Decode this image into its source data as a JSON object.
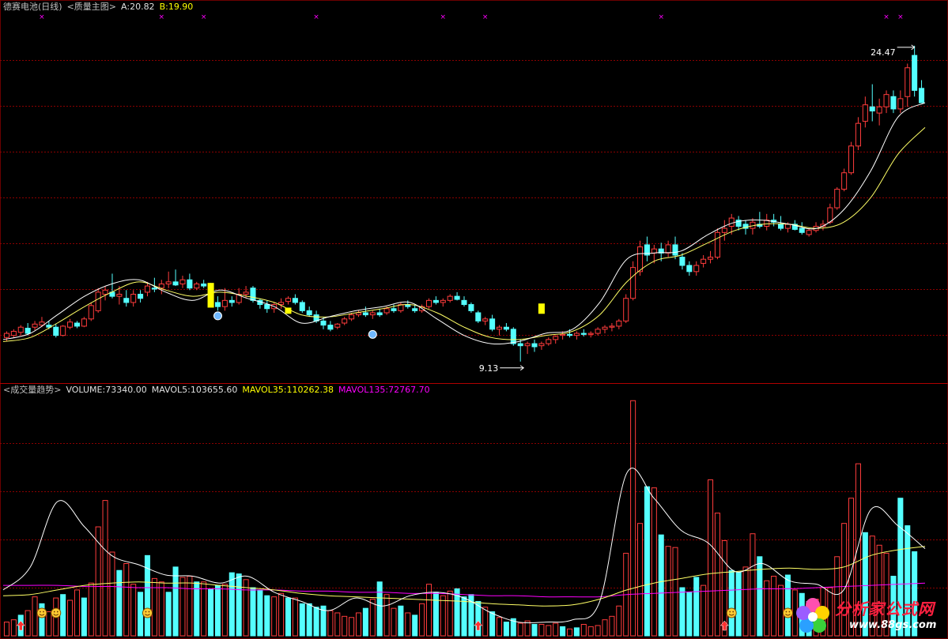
{
  "header": {
    "stock_name": "德赛电池(日线)",
    "indicator_main": "<质量主图>",
    "a_label": "A:20.82",
    "b_label": "B:19.90"
  },
  "volume_header": {
    "indicator": "<成交量趋势>",
    "volume": "VOLUME:73340.00",
    "mavol5": "MAVOL5:103655.60",
    "mavol35": "MAVOL35:110262.38",
    "mavol135": "MAVOL135:72767.70"
  },
  "annotations": {
    "high_label": "24.47",
    "low_label": "9.13"
  },
  "logo": {
    "text": "分析家公式网",
    "url": "www.88gs.com"
  },
  "colors": {
    "background": "#000000",
    "up": "#ff3c3c",
    "down": "#54ffff",
    "ma_short": "#ffffff",
    "ma_long": "#ffff66",
    "ma_vol135": "#ff00ff",
    "grid": "#8b0000",
    "marker_x": "#ff00ff",
    "signal_yellow": "#ffff00"
  },
  "chart_data": [
    {
      "type": "candlestick",
      "title": "德赛电池(日线)",
      "ylim": [
        8.2,
        26.0
      ],
      "grid": true,
      "ohlc": [
        [
          10.3,
          10.6,
          10.1,
          10.5
        ],
        [
          10.4,
          10.7,
          10.3,
          10.6
        ],
        [
          10.55,
          10.9,
          10.4,
          10.8
        ],
        [
          10.75,
          11.0,
          10.4,
          10.5
        ],
        [
          10.8,
          11.1,
          10.65,
          10.95
        ],
        [
          10.9,
          11.3,
          10.8,
          11.05
        ],
        [
          10.9,
          11.1,
          10.7,
          10.8
        ],
        [
          10.8,
          10.95,
          10.3,
          10.4
        ],
        [
          10.4,
          10.9,
          10.35,
          10.85
        ],
        [
          10.8,
          11.2,
          10.7,
          11.05
        ],
        [
          11.0,
          11.1,
          10.75,
          10.85
        ],
        [
          10.85,
          11.3,
          10.8,
          11.2
        ],
        [
          11.2,
          12.0,
          11.1,
          11.85
        ],
        [
          11.6,
          12.7,
          11.5,
          12.5
        ],
        [
          12.4,
          12.8,
          12.1,
          12.6
        ],
        [
          12.5,
          13.4,
          12.2,
          12.3
        ],
        [
          12.3,
          12.8,
          11.9,
          12.4
        ],
        [
          12.2,
          12.6,
          11.8,
          12.0
        ],
        [
          12.0,
          12.6,
          11.8,
          12.4
        ],
        [
          12.4,
          12.6,
          12.0,
          12.2
        ],
        [
          12.5,
          13.0,
          12.3,
          12.8
        ],
        [
          12.7,
          13.2,
          12.5,
          12.65
        ],
        [
          12.7,
          13.1,
          12.4,
          12.9
        ],
        [
          12.9,
          13.5,
          12.7,
          13.0
        ],
        [
          13.0,
          13.6,
          12.8,
          12.85
        ],
        [
          12.9,
          13.3,
          12.7,
          13.1
        ],
        [
          13.1,
          13.4,
          12.6,
          12.7
        ],
        [
          12.7,
          13.0,
          12.6,
          12.9
        ],
        [
          12.9,
          13.1,
          12.7,
          12.8
        ],
        [
          12.9,
          12.95,
          11.8,
          12.0
        ],
        [
          12.0,
          12.3,
          11.6,
          11.8
        ],
        [
          11.8,
          12.7,
          11.6,
          12.1
        ],
        [
          12.1,
          12.3,
          11.8,
          12.0
        ],
        [
          12.0,
          12.7,
          11.9,
          12.4
        ],
        [
          12.4,
          12.8,
          12.2,
          12.5
        ],
        [
          12.7,
          12.8,
          12.0,
          12.1
        ],
        [
          12.1,
          12.2,
          11.7,
          11.9
        ],
        [
          11.9,
          12.1,
          11.5,
          11.7
        ],
        [
          11.7,
          12.0,
          11.5,
          11.9
        ],
        [
          11.9,
          12.2,
          11.7,
          12.0
        ],
        [
          12.05,
          12.3,
          11.9,
          12.2
        ],
        [
          12.2,
          12.4,
          11.9,
          12.0
        ],
        [
          12.0,
          12.1,
          11.5,
          11.6
        ],
        [
          11.6,
          11.8,
          11.3,
          11.4
        ],
        [
          11.4,
          11.6,
          11.0,
          11.1
        ],
        [
          11.1,
          11.3,
          10.7,
          10.9
        ],
        [
          10.9,
          11.1,
          10.6,
          10.7
        ],
        [
          10.8,
          11.0,
          10.7,
          10.95
        ],
        [
          11.0,
          11.3,
          10.9,
          11.2
        ],
        [
          11.2,
          11.5,
          11.1,
          11.4
        ],
        [
          11.4,
          11.6,
          11.3,
          11.5
        ],
        [
          11.5,
          11.8,
          11.3,
          11.4
        ],
        [
          11.4,
          11.6,
          11.2,
          11.5
        ],
        [
          11.5,
          11.7,
          11.3,
          11.4
        ],
        [
          11.5,
          11.8,
          11.4,
          11.7
        ],
        [
          11.7,
          11.9,
          11.5,
          11.6
        ],
        [
          11.6,
          12.0,
          11.5,
          11.9
        ],
        [
          11.9,
          12.1,
          11.7,
          11.8
        ],
        [
          11.7,
          11.9,
          11.5,
          11.6
        ],
        [
          11.6,
          11.9,
          11.5,
          11.8
        ],
        [
          11.8,
          12.2,
          11.7,
          12.1
        ],
        [
          12.1,
          12.3,
          11.9,
          12.0
        ],
        [
          12.0,
          12.2,
          11.8,
          12.1
        ],
        [
          12.1,
          12.4,
          12.0,
          12.3
        ],
        [
          12.3,
          12.5,
          12.1,
          12.15
        ],
        [
          12.1,
          12.3,
          11.8,
          11.9
        ],
        [
          11.9,
          12.0,
          11.5,
          11.6
        ],
        [
          11.5,
          11.6,
          11.0,
          11.1
        ],
        [
          11.1,
          11.3,
          10.9,
          11.2
        ],
        [
          11.2,
          11.4,
          10.6,
          10.7
        ],
        [
          10.7,
          10.9,
          10.4,
          10.8
        ],
        [
          10.8,
          11.0,
          10.6,
          10.7
        ],
        [
          10.7,
          10.8,
          9.9,
          10.0
        ],
        [
          10.0,
          10.2,
          9.13,
          9.9
        ],
        [
          9.9,
          10.1,
          9.5,
          10.0
        ],
        [
          10.0,
          10.2,
          9.6,
          9.85
        ],
        [
          9.9,
          10.1,
          9.7,
          10.0
        ],
        [
          10.0,
          10.3,
          9.9,
          10.2
        ],
        [
          10.2,
          10.4,
          10.0,
          10.35
        ],
        [
          10.4,
          10.6,
          10.2,
          10.45
        ],
        [
          10.45,
          10.7,
          10.3,
          10.4
        ],
        [
          10.4,
          10.6,
          10.2,
          10.5
        ],
        [
          10.5,
          10.7,
          10.35,
          10.45
        ],
        [
          10.45,
          10.6,
          10.3,
          10.5
        ],
        [
          10.5,
          10.8,
          10.4,
          10.7
        ],
        [
          10.7,
          10.9,
          10.5,
          10.8
        ],
        [
          10.8,
          11.0,
          10.6,
          10.85
        ],
        [
          10.85,
          11.2,
          10.7,
          11.1
        ],
        [
          11.1,
          12.4,
          11.0,
          12.2
        ],
        [
          12.2,
          14.0,
          12.1,
          13.7
        ],
        [
          13.5,
          15.0,
          13.3,
          14.7
        ],
        [
          14.8,
          15.2,
          14.0,
          14.3
        ],
        [
          14.4,
          14.8,
          13.9,
          14.6
        ],
        [
          14.6,
          14.9,
          14.0,
          14.4
        ],
        [
          14.4,
          15.0,
          14.2,
          14.8
        ],
        [
          14.8,
          15.2,
          14.1,
          14.3
        ],
        [
          14.2,
          14.4,
          13.6,
          13.8
        ],
        [
          13.8,
          14.0,
          13.3,
          13.5
        ],
        [
          13.5,
          14.0,
          13.3,
          13.8
        ],
        [
          13.9,
          14.3,
          13.7,
          14.1
        ],
        [
          14.1,
          14.5,
          13.9,
          14.2
        ],
        [
          14.2,
          15.6,
          14.1,
          15.4
        ],
        [
          15.4,
          16.0,
          15.0,
          15.6
        ],
        [
          15.7,
          16.3,
          15.3,
          16.1
        ],
        [
          16.0,
          16.2,
          15.5,
          15.7
        ],
        [
          15.8,
          16.0,
          15.3,
          15.6
        ],
        [
          15.6,
          16.1,
          15.3,
          15.9
        ],
        [
          15.8,
          16.4,
          15.6,
          15.7
        ],
        [
          15.7,
          16.3,
          15.5,
          16.0
        ],
        [
          16.0,
          16.3,
          15.7,
          15.9
        ],
        [
          15.8,
          16.2,
          15.5,
          15.6
        ],
        [
          15.6,
          15.9,
          15.4,
          15.8
        ],
        [
          15.8,
          16.0,
          15.5,
          15.55
        ],
        [
          15.6,
          15.9,
          15.3,
          15.4
        ],
        [
          15.3,
          15.6,
          15.2,
          15.5
        ],
        [
          15.5,
          15.9,
          15.4,
          15.7
        ],
        [
          15.7,
          16.0,
          15.5,
          15.8
        ],
        [
          15.9,
          16.8,
          15.8,
          16.6
        ],
        [
          16.6,
          17.6,
          16.5,
          17.5
        ],
        [
          17.5,
          18.5,
          17.4,
          18.3
        ],
        [
          18.3,
          19.8,
          18.2,
          19.6
        ],
        [
          19.6,
          21.0,
          19.4,
          20.7
        ],
        [
          20.8,
          22.0,
          20.5,
          21.6
        ],
        [
          21.5,
          22.6,
          20.8,
          21.3
        ],
        [
          21.2,
          21.9,
          20.6,
          21.5
        ],
        [
          21.5,
          22.3,
          21.2,
          22.1
        ],
        [
          22.0,
          22.3,
          21.2,
          21.4
        ],
        [
          21.4,
          22.3,
          21.2,
          21.9
        ],
        [
          22.0,
          23.6,
          21.5,
          23.4
        ],
        [
          24.0,
          24.47,
          22.0,
          22.3
        ],
        [
          22.4,
          22.8,
          21.7,
          21.7
        ]
      ],
      "ma_short_anchors": [
        10.2,
        10.5,
        11.4,
        12.3,
        12.9,
        13.1,
        12.5,
        12.1,
        12.6,
        12.2,
        11.8,
        11.0,
        11.3,
        11.6,
        11.8,
        12.0,
        11.2,
        10.4,
        10.0,
        10.1,
        10.5,
        10.7,
        12.0,
        14.1,
        14.4,
        14.5,
        15.3,
        15.9,
        16.0,
        15.8,
        15.6,
        16.5,
        18.4,
        21.0,
        21.7
      ],
      "ma_long_anchors": [
        10.1,
        10.3,
        11.0,
        11.8,
        12.5,
        13.0,
        12.6,
        12.3,
        12.5,
        12.3,
        12.0,
        11.4,
        11.3,
        11.5,
        11.7,
        11.9,
        11.5,
        10.8,
        10.3,
        10.2,
        10.4,
        10.6,
        11.4,
        13.0,
        14.0,
        14.3,
        14.9,
        15.5,
        15.8,
        15.8,
        15.6,
        15.9,
        17.1,
        19.2,
        20.5
      ],
      "high_marker": 24.47,
      "low_marker": 9.13
    },
    {
      "type": "bar",
      "title": "<成交量趋势>",
      "ylim": [
        0,
        210000
      ],
      "grid": true,
      "volume": [
        12000,
        14000,
        18000,
        22000,
        34000,
        28000,
        21000,
        33000,
        36000,
        31000,
        40000,
        33000,
        46000,
        95000,
        118000,
        73000,
        57000,
        63000,
        45000,
        38000,
        70000,
        50000,
        47000,
        38000,
        60000,
        51000,
        52000,
        47000,
        47000,
        41000,
        44000,
        45000,
        55000,
        54000,
        49000,
        42000,
        40000,
        35000,
        34000,
        37000,
        33000,
        33000,
        28000,
        28000,
        25000,
        26000,
        22000,
        20000,
        17000,
        16000,
        20000,
        24000,
        32000,
        47000,
        36000,
        24000,
        26000,
        20000,
        18000,
        28000,
        45000,
        38000,
        35000,
        39000,
        41000,
        34000,
        36000,
        30000,
        25000,
        21000,
        16000,
        12000,
        15000,
        11000,
        13000,
        10000,
        10000,
        9000,
        11000,
        8000,
        6000,
        7000,
        10000,
        8000,
        9000,
        14000,
        17000,
        26000,
        72000,
        205000,
        98000,
        130000,
        129000,
        88000,
        78000,
        77000,
        42000,
        38000,
        51000,
        44000,
        136000,
        107000,
        83000,
        57000,
        55000,
        60000,
        89000,
        69000,
        48000,
        52000,
        44000,
        53000,
        40000,
        37000,
        30000,
        32000,
        42000,
        42000,
        69000,
        98000,
        120000,
        150000,
        90000,
        87000,
        79000,
        72000,
        52000,
        120000,
        96000,
        73340
      ],
      "vol_up": [
        1,
        1,
        0,
        1,
        1,
        0,
        1,
        1,
        0,
        1,
        1,
        0,
        1,
        1,
        1,
        1,
        0,
        1,
        1,
        0,
        0,
        1,
        1,
        0,
        0,
        1,
        1,
        0,
        1,
        0,
        0,
        1,
        0,
        0,
        1,
        0,
        0,
        0,
        1,
        1,
        0,
        1,
        0,
        0,
        0,
        0,
        1,
        1,
        1,
        1,
        1,
        0,
        1,
        0,
        1,
        1,
        0,
        1,
        0,
        1,
        1,
        0,
        1,
        1,
        0,
        0,
        0,
        0,
        1,
        0,
        1,
        0,
        0,
        1,
        1,
        0,
        1,
        1,
        1,
        0,
        1,
        0,
        1,
        1,
        1,
        1,
        1,
        1,
        1,
        1,
        1,
        0,
        1,
        0,
        1,
        1,
        0,
        0,
        0,
        1,
        1,
        1,
        1,
        0,
        0,
        1,
        1,
        0,
        1,
        1,
        1,
        0,
        1,
        0,
        0,
        1,
        1,
        1,
        1,
        1,
        1,
        1,
        0,
        1,
        1,
        1,
        0,
        0,
        0
      ],
      "ma5_anchors": [
        40000,
        60000,
        117000,
        95000,
        70000,
        62000,
        53000,
        52000,
        46000,
        52000,
        38000,
        30000,
        22000,
        33000,
        26000,
        35000,
        38000,
        33000,
        20000,
        12000,
        12000,
        14000,
        30000,
        142000,
        120000,
        92000,
        81000,
        56000,
        63000,
        48000,
        45000,
        40000,
        110000,
        96000,
        76000
      ],
      "ma35_anchors": [
        35000,
        36000,
        40000,
        44000,
        46000,
        47000,
        46000,
        46000,
        44000,
        42000,
        40000,
        37000,
        35000,
        34000,
        33000,
        32000,
        31000,
        30000,
        28000,
        27000,
        26000,
        27000,
        32000,
        40000,
        46000,
        50000,
        54000,
        56000,
        58000,
        59000,
        58000,
        60000,
        70000,
        75000,
        78000
      ],
      "ma135_anchors": [
        44000,
        44000,
        44000,
        43000,
        43000,
        42000,
        42000,
        41000,
        41000,
        40000,
        40000,
        39000,
        39000,
        38000,
        38000,
        37000,
        37000,
        36000,
        35000,
        35000,
        34000,
        34000,
        34000,
        36000,
        37000,
        38000,
        39000,
        40000,
        41000,
        41000,
        42000,
        43000,
        44000,
        45000,
        46000
      ]
    }
  ]
}
